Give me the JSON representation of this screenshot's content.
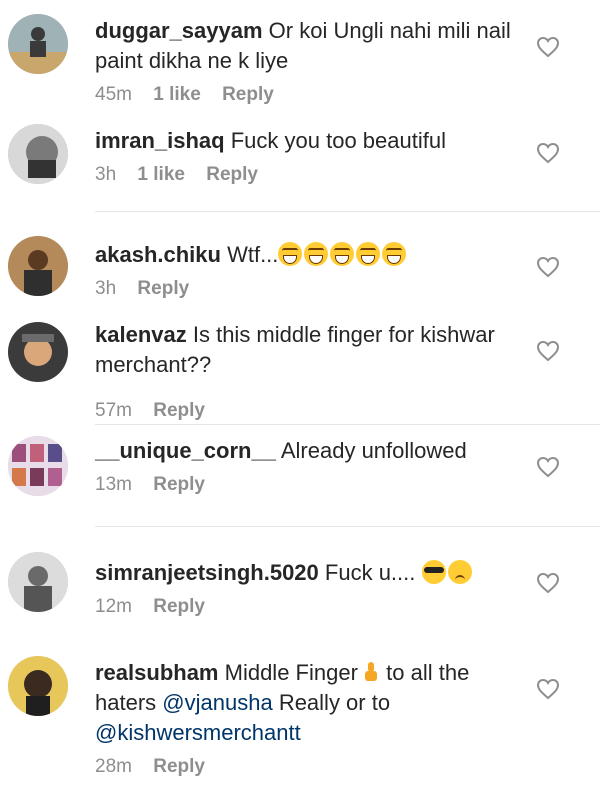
{
  "comments": [
    {
      "username": "duggar_sayyam",
      "text": "Or koi Ungli nahi mili nail paint dikha ne k liye",
      "time": "45m",
      "likes": "1 like",
      "reply": "Reply"
    },
    {
      "username": "imran_ishaq",
      "text": "Fuck you too beautiful",
      "time": "3h",
      "likes": "1 like",
      "reply": "Reply"
    },
    {
      "username": "akash.chiku",
      "text": "Wtf...",
      "time": "3h",
      "reply": "Reply"
    },
    {
      "username": "kalenvaz",
      "text": "Is this middle finger for kishwar merchant??",
      "time": "57m",
      "reply": "Reply"
    },
    {
      "username": "__unique_corn__",
      "text": "Already unfollowed",
      "time": "13m",
      "reply": "Reply"
    },
    {
      "username": "simranjeetsingh.5020",
      "text": "Fuck u....",
      "time": "12m",
      "reply": "Reply"
    },
    {
      "username": "realsubham",
      "text_before": "Middle Finger",
      "text_mid": "to all the haters",
      "mention1": "@vjanusha",
      "text_after": "Really or to",
      "mention2": "@kishwersmerchantt",
      "time": "28m",
      "reply": "Reply"
    }
  ],
  "colors": {
    "text": "#262626",
    "meta": "#8e8e8e",
    "mention": "#003569",
    "divider": "#e6e6e6"
  },
  "icons": {
    "like": "heart-outline-icon"
  }
}
